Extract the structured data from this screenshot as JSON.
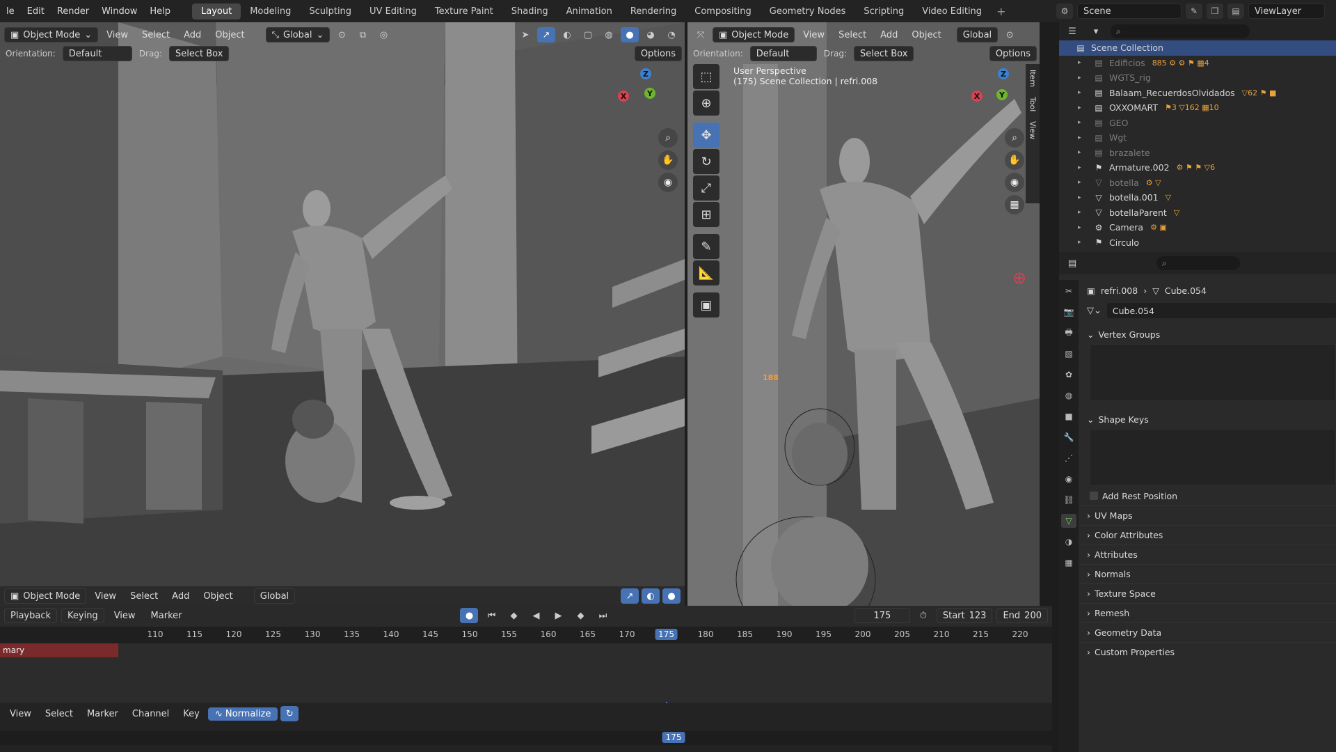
{
  "menu": {
    "items": [
      "le",
      "Edit",
      "Render",
      "Window",
      "Help"
    ]
  },
  "workspaces": {
    "tabs": [
      "Layout",
      "Modeling",
      "Sculpting",
      "UV Editing",
      "Texture Paint",
      "Shading",
      "Animation",
      "Rendering",
      "Compositing",
      "Geometry Nodes",
      "Scripting",
      "Video Editing"
    ],
    "active": "Layout",
    "add": "+"
  },
  "scene": {
    "name": "Scene",
    "view_layer": "ViewLayer"
  },
  "viewport_left": {
    "mode": "Object Mode",
    "menus": [
      "View",
      "Select",
      "Add",
      "Object"
    ],
    "transform": "Global",
    "orientation_label": "Orientation:",
    "orientation_value": "Default",
    "drag_label": "Drag:",
    "drag_value": "Select Box",
    "options": "Options"
  },
  "viewport_right": {
    "mode": "Object Mode",
    "menus": [
      "View",
      "Select",
      "Add",
      "Object"
    ],
    "transform": "Global",
    "orientation_label": "Orientation:",
    "orientation_value": "Default",
    "drag_label": "Drag:",
    "drag_value": "Select Box",
    "options": "Options",
    "overlay_line1": "User Perspective",
    "overlay_line2": "(175) Scene Collection | refri.008",
    "side_tabs": [
      "Item",
      "Tool",
      "View"
    ],
    "marker_text": "188"
  },
  "viewport_bottom_header": {
    "mode": "Object Mode",
    "menus": [
      "View",
      "Select",
      "Add",
      "Object"
    ],
    "transform": "Global"
  },
  "gizmo": {
    "z": "Z",
    "y": "Y",
    "x": "X"
  },
  "outliner": {
    "rows": [
      {
        "label": "Scene Collection",
        "icon": "collection",
        "selected": true,
        "dim": false,
        "badges": ""
      },
      {
        "label": "Edificios",
        "icon": "collection",
        "selected": false,
        "dim": true,
        "badges": "885 ⚙ ⚙ ⚑ ▦4"
      },
      {
        "label": "WGTS_rig",
        "icon": "collection",
        "selected": false,
        "dim": true,
        "badges": ""
      },
      {
        "label": "Balaam_RecuerdosOlvidados",
        "icon": "collection",
        "selected": false,
        "dim": false,
        "badges": "▽62 ⚑ ■"
      },
      {
        "label": "OXXOMART",
        "icon": "collection",
        "selected": false,
        "dim": false,
        "badges": "⚑3 ▽162 ▦10"
      },
      {
        "label": "GEO",
        "icon": "collection",
        "selected": false,
        "dim": true,
        "badges": ""
      },
      {
        "label": "Wgt",
        "icon": "collection",
        "selected": false,
        "dim": true,
        "badges": ""
      },
      {
        "label": "brazalete",
        "icon": "collection",
        "selected": false,
        "dim": true,
        "badges": ""
      },
      {
        "label": "Armature.002",
        "icon": "armature",
        "selected": false,
        "dim": false,
        "badges": "⚙ ⚑ ⚑ ▽6"
      },
      {
        "label": "botella",
        "icon": "mesh",
        "selected": false,
        "dim": true,
        "badges": "⚙ ▽"
      },
      {
        "label": "botella.001",
        "icon": "mesh",
        "selected": false,
        "dim": false,
        "badges": "▽"
      },
      {
        "label": "botellaParent",
        "icon": "mesh",
        "selected": false,
        "dim": false,
        "badges": "▽"
      },
      {
        "label": "Camera",
        "icon": "camera",
        "selected": false,
        "dim": false,
        "badges": "⚙ ▣"
      },
      {
        "label": "Circulo",
        "icon": "armature",
        "selected": false,
        "dim": false,
        "badges": ""
      }
    ]
  },
  "properties": {
    "breadcrumb_object": "refri.008",
    "breadcrumb_mesh": "Cube.054",
    "mesh_name": "Cube.054",
    "panels": {
      "vertex_groups": "Vertex Groups",
      "shape_keys": "Shape Keys",
      "add_rest_position": "Add Rest Position"
    },
    "collapsed_panels": [
      "UV Maps",
      "Color Attributes",
      "Attributes",
      "Normals",
      "Texture Space",
      "Remesh",
      "Geometry Data",
      "Custom Properties"
    ]
  },
  "timeline": {
    "menus": [
      "Playback",
      "Keying",
      "View",
      "Marker"
    ],
    "current_frame": "175",
    "start_label": "Start",
    "start": "123",
    "end_label": "End",
    "end": "200",
    "ticks": [
      "110",
      "115",
      "120",
      "125",
      "130",
      "135",
      "140",
      "145",
      "150",
      "155",
      "160",
      "165",
      "170",
      "175",
      "180",
      "185",
      "190",
      "195",
      "200",
      "205",
      "210",
      "215",
      "220"
    ],
    "summary": "mary"
  },
  "graph_editor": {
    "menus": [
      "View",
      "Select",
      "Marker",
      "Channel",
      "Key"
    ],
    "normalize": "Normalize",
    "playhead": "175"
  }
}
